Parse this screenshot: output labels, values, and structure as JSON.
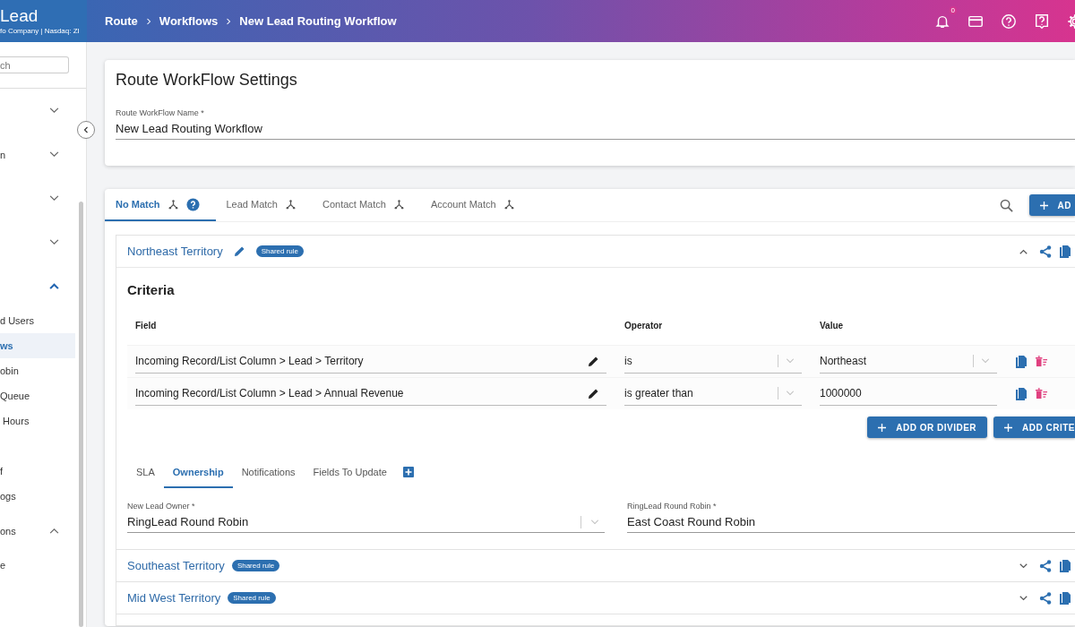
{
  "app_header": {
    "brand": "Lead",
    "tagline": "fo Company | Nasdaq: ZI"
  },
  "breadcrumbs": [
    "Route",
    "Workflows",
    "New Lead Routing Workflow"
  ],
  "notifications": {
    "count": "0"
  },
  "sidebar": {
    "search": {
      "placeholder": "ch"
    },
    "items": [
      {
        "kind": "group",
        "expanded": false,
        "selected": false
      },
      {
        "kind": "group",
        "label": "n",
        "expanded": false,
        "selected": false
      },
      {
        "kind": "group",
        "expanded": false,
        "selected": false
      },
      {
        "kind": "group",
        "expanded": false,
        "selected": false
      },
      {
        "kind": "group",
        "expanded": true,
        "selected": true
      },
      {
        "kind": "link",
        "label": "d Users",
        "selected": false
      },
      {
        "kind": "link",
        "label": "ws",
        "selected": true
      },
      {
        "kind": "link",
        "label": "obin",
        "selected": false
      },
      {
        "kind": "link",
        "label": "Queue",
        "selected": false
      },
      {
        "kind": "link",
        "label": " Hours",
        "selected": false
      },
      {
        "kind": "link",
        "selected": false
      },
      {
        "kind": "link",
        "label": "f",
        "selected": false
      },
      {
        "kind": "link",
        "label": "ogs",
        "selected": false
      },
      {
        "kind": "group",
        "label": "ons",
        "expanded": true,
        "selected": false
      },
      {
        "kind": "link",
        "label": "e",
        "selected": false
      }
    ]
  },
  "settings": {
    "title": "Route WorkFlow Settings",
    "name_field": {
      "label": "Route WorkFlow Name *",
      "value": "New Lead Routing Workflow"
    }
  },
  "match_tabs": [
    {
      "label": "No Match",
      "selected": true,
      "help": true
    },
    {
      "label": "Lead Match",
      "selected": false,
      "help": false
    },
    {
      "label": "Contact Match",
      "selected": false,
      "help": false
    },
    {
      "label": "Account Match",
      "selected": false,
      "help": false
    }
  ],
  "add_button": "AD",
  "rules": [
    {
      "name": "Northeast Territory",
      "badge": "Shared rule",
      "expanded": true,
      "criteria": {
        "title": "Criteria",
        "columns": [
          "Field",
          "Operator",
          "Value"
        ],
        "rows": [
          {
            "field": "Incoming Record/List Column > Lead > Territory",
            "operator": "is",
            "value": "Northeast",
            "kind": "select"
          },
          {
            "field": "Incoming Record/List Column > Lead > Annual Revenue",
            "operator": "is greater than",
            "value": "1000000",
            "kind": "text"
          }
        ],
        "buttons": [
          "ADD OR DIVIDER",
          "ADD CRITE"
        ]
      },
      "sub_tabs": [
        {
          "label": "SLA",
          "selected": false
        },
        {
          "label": "Ownership",
          "selected": true
        },
        {
          "label": "Notifications",
          "selected": false
        },
        {
          "label": "Fields To Update",
          "selected": false
        }
      ],
      "fields": [
        {
          "label": "New Lead Owner *",
          "value": "RingLead Round Robin",
          "kind": "select"
        },
        {
          "label": "RingLead Round Robin *",
          "value": "East Coast Round Robin",
          "kind": "text"
        }
      ]
    },
    {
      "name": "Southeast Territory",
      "badge": "Shared rule",
      "expanded": false
    },
    {
      "name": "Mid West Territory",
      "badge": "Shared rule",
      "expanded": false
    }
  ]
}
